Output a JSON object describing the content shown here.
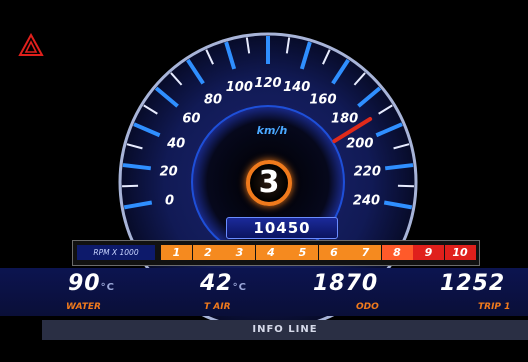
{
  "hazard": {
    "icon": "hazard-warning-icon"
  },
  "speedometer": {
    "unit": "km/h",
    "ticks": [
      "0",
      "20",
      "40",
      "60",
      "80",
      "100",
      "120",
      "140",
      "160",
      "180",
      "200",
      "220",
      "240"
    ],
    "speed_value_kmh": 190,
    "odometer_display": "10450",
    "gear": "3"
  },
  "rpm": {
    "label": "RPM X 1000",
    "segments": [
      "1",
      "2",
      "3",
      "4",
      "5",
      "6",
      "7",
      "8",
      "9",
      "10"
    ],
    "colors": {
      "normal": "#f58a1f",
      "warn": "#ff5a2a",
      "redline": "#e0201c"
    }
  },
  "readouts": [
    {
      "value": "90",
      "unit": "°C",
      "label": "WATER"
    },
    {
      "value": "42",
      "unit": "°C",
      "label": "T AIR"
    },
    {
      "value": "1870",
      "unit": "",
      "label": "ODO"
    },
    {
      "value": "1252",
      "unit": "",
      "label": "TRIP 1"
    }
  ],
  "info_line": "INFO LINE",
  "colors": {
    "accent_blue": "#2f8fff",
    "needle": "#e02a1a",
    "orange": "#f07a1c"
  }
}
